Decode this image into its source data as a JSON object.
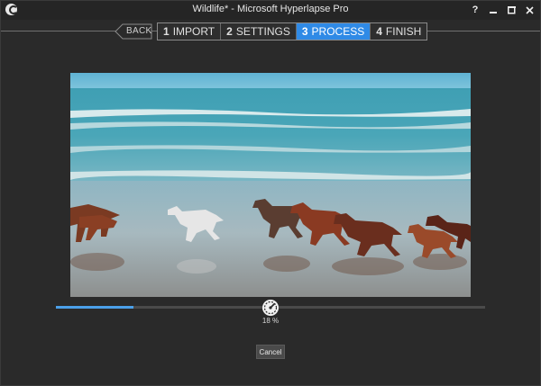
{
  "window": {
    "title": "Wildlife* - Microsoft Hyperlapse Pro",
    "help_label": "?",
    "minimize_icon": "minimize-icon",
    "maximize_icon": "maximize-icon",
    "close_icon": "close-icon"
  },
  "nav": {
    "back_label": "BACK",
    "steps": [
      {
        "num": "1",
        "label": "IMPORT",
        "active": false
      },
      {
        "num": "2",
        "label": "SETTINGS",
        "active": false
      },
      {
        "num": "3",
        "label": "PROCESS",
        "active": true
      },
      {
        "num": "4",
        "label": "FINISH",
        "active": false
      }
    ]
  },
  "preview": {
    "icon": "video-preview-horses-on-beach"
  },
  "progress": {
    "value": 0.18,
    "percent_label": "18 %",
    "icon": "speedometer-icon"
  },
  "actions": {
    "cancel_label": "Cancel"
  },
  "colors": {
    "accent": "#2f8ae6",
    "progress_fill": "#4b9fe8",
    "background": "#2a2a2a"
  }
}
